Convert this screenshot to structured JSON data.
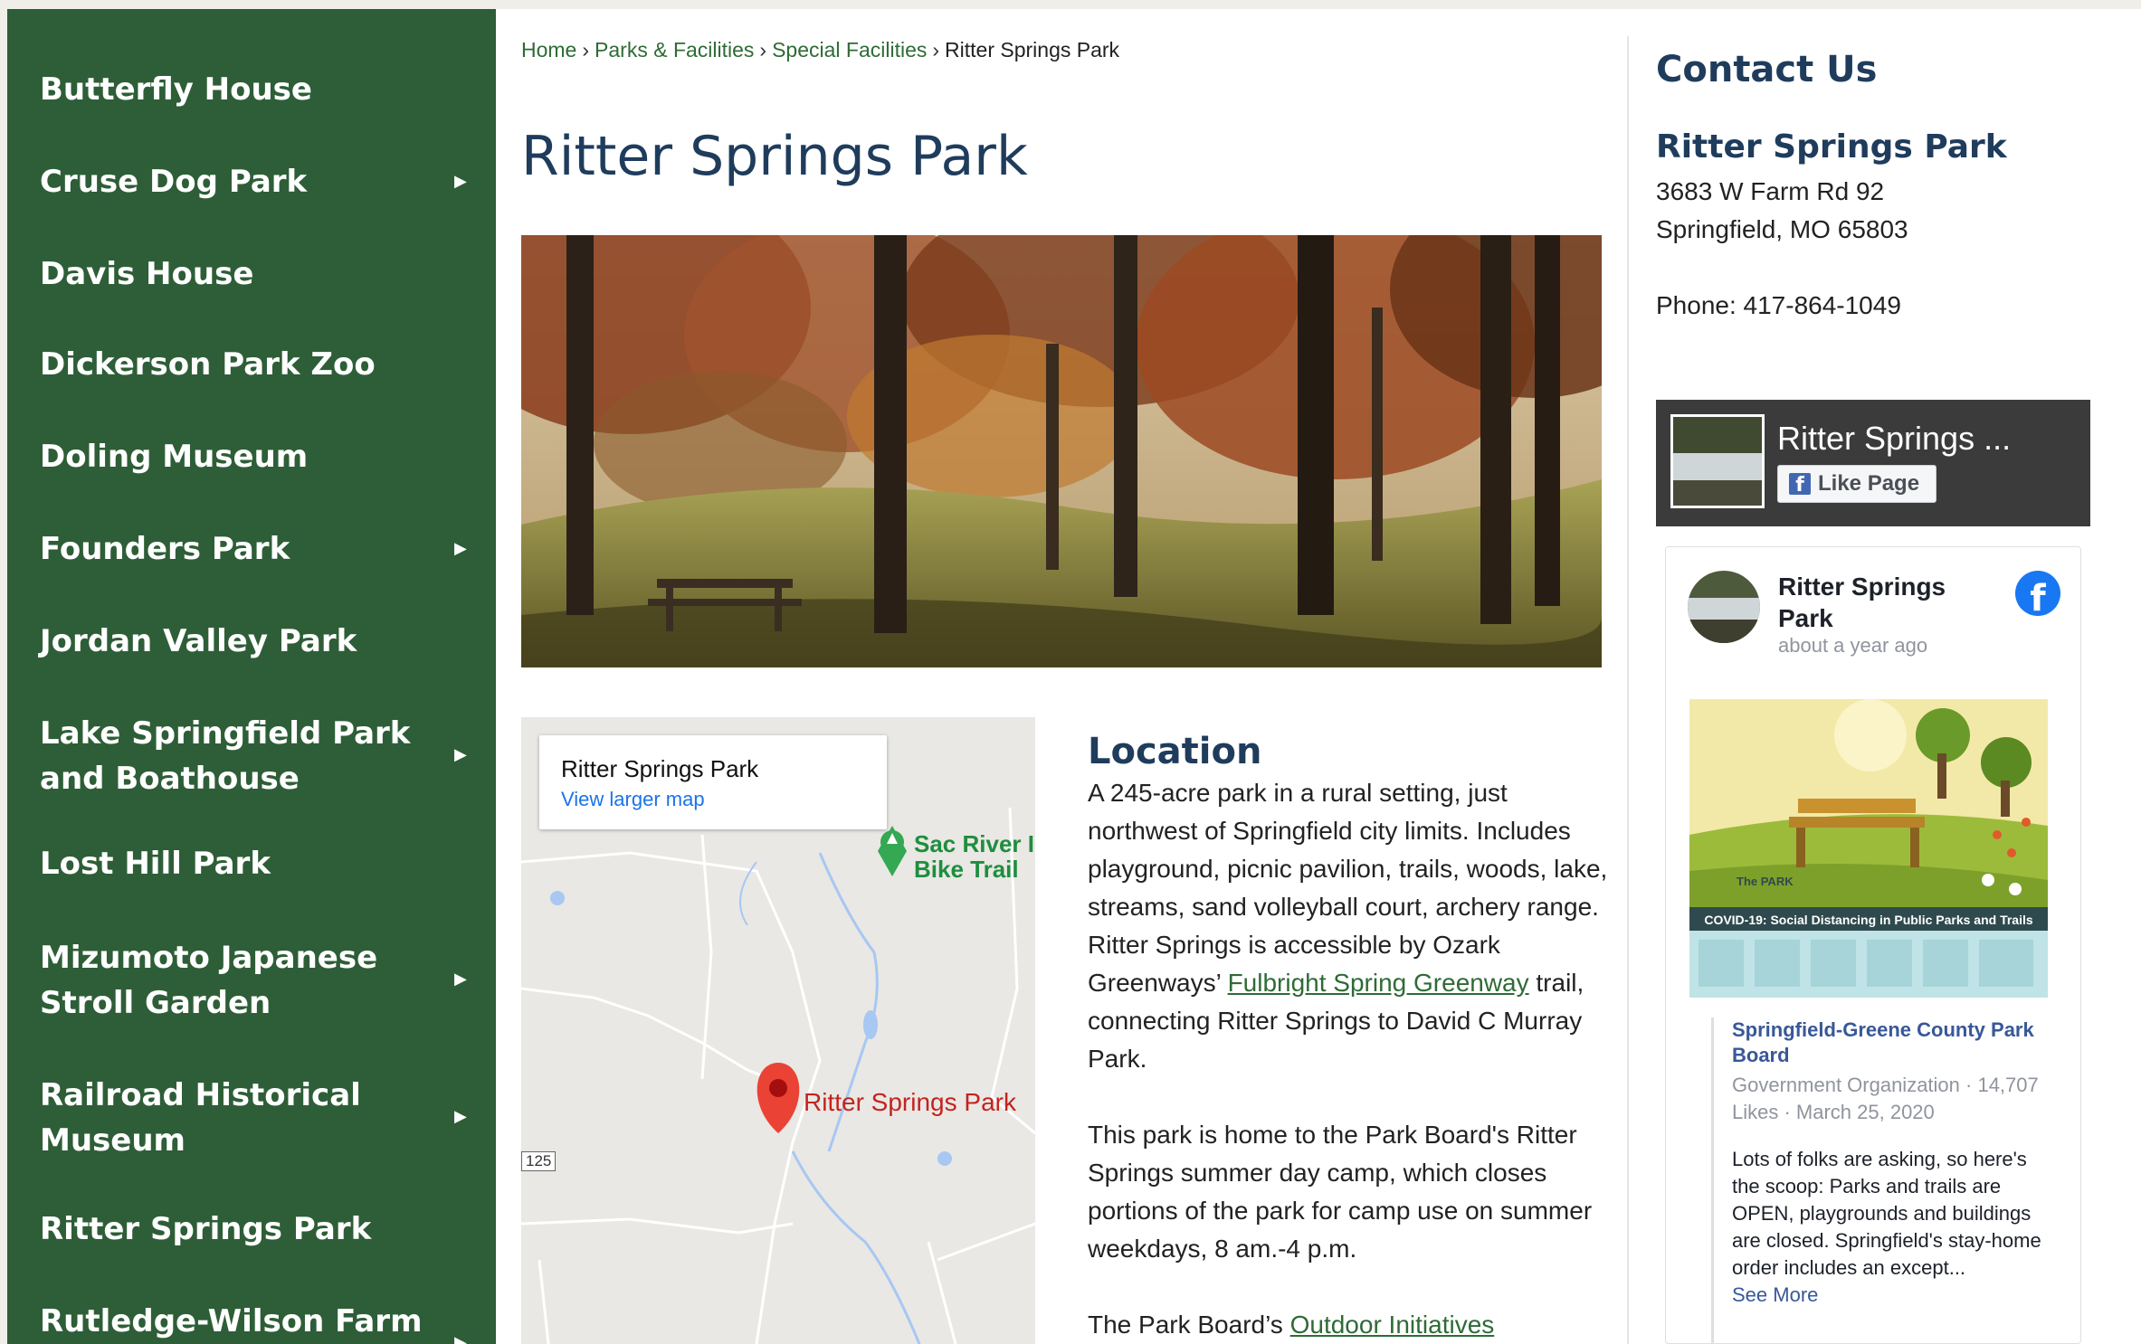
{
  "sidebar": {
    "items": [
      {
        "label": "Butterfly House",
        "has_submenu": false
      },
      {
        "label": "Cruse Dog Park",
        "has_submenu": true
      },
      {
        "label": "Davis House",
        "has_submenu": false
      },
      {
        "label": "Dickerson Park Zoo",
        "has_submenu": false
      },
      {
        "label": "Doling Museum",
        "has_submenu": false
      },
      {
        "label": "Founders Park",
        "has_submenu": true
      },
      {
        "label": "Jordan Valley Park",
        "has_submenu": false
      },
      {
        "label": "Lake Springfield Park and Boathouse",
        "has_submenu": true
      },
      {
        "label": "Lost Hill Park",
        "has_submenu": false
      },
      {
        "label": "Mizumoto Japanese Stroll Garden",
        "has_submenu": true
      },
      {
        "label": "Railroad Historical Museum",
        "has_submenu": true
      },
      {
        "label": "Ritter Springs Park",
        "has_submenu": false
      },
      {
        "label": "Rutledge-Wilson Farm",
        "has_submenu": true
      }
    ],
    "arrow_glyph": "▶"
  },
  "breadcrumb": {
    "home": "Home",
    "parks": "Parks & Facilities",
    "special": "Special Facilities",
    "current": "Ritter Springs Park",
    "separator": "›"
  },
  "main": {
    "title": "Ritter Springs Park"
  },
  "map": {
    "card_title": "Ritter Springs Park",
    "card_link": "View larger map",
    "park_label": "Ritter Springs Park",
    "trail_label_1": "Sac River I",
    "trail_label_2": "Bike Trail",
    "route_number": "125"
  },
  "location": {
    "heading": "Location",
    "p1_before": "A 245-acre park in a rural setting, just northwest of Springfield city limits. Includes playground, picnic pavilion, trails, woods, lake, streams, sand volleyball court, archery range. Ritter Springs is accessible by Ozark Greenways’ ",
    "p1_link": "Fulbright Spring Greenway",
    "p1_after": " trail, connecting Ritter Springs to David C Murray Park.",
    "p2": "This park is home to the Park Board's Ritter Springs summer day camp, which closes portions of the park for camp use on summer weekdays, 8 am.-4 p.m.",
    "p3_before": "The Park Board’s ",
    "p3_link": "Outdoor Initiatives"
  },
  "contact": {
    "heading": "Contact Us",
    "name": "Ritter Springs Park",
    "address1": "3683 W Farm Rd 92",
    "address2": "Springfield, MO 65803",
    "phone": "Phone: 417-864-1049"
  },
  "facebook": {
    "cover_name": "Ritter Springs ...",
    "like_label": "Like Page",
    "post_name": "Ritter Springs Park",
    "post_time": "about a year ago",
    "image_caption": "COVID-19: Social Distancing in Public Parks and Trails",
    "image_brand": "The PARK",
    "shared_name": "Springfield-Greene County Park Board",
    "shared_meta": "Government Organization · 14,707 Likes · March 25, 2020",
    "shared_text": "Lots of folks are asking, so here's the scoop: Parks and trails are OPEN, playgrounds and buildings are closed. Springfield's stay-home order includes an except...",
    "see_more": "See More"
  },
  "colors": {
    "sidebar_bg": "#2e5e37",
    "heading_blue": "#1f3c5c",
    "link_green": "#2e6b36",
    "fb_blue": "#1877f2"
  }
}
